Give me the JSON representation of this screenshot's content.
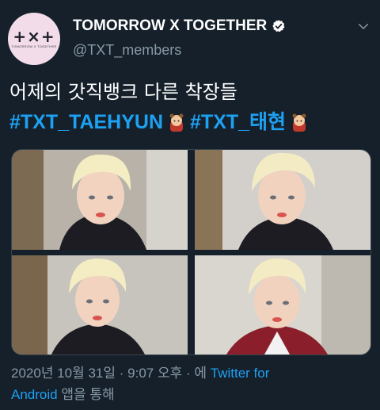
{
  "account": {
    "name": "TOMORROW X TOGETHER",
    "handle": "@TXT_members",
    "logo_text": "+×+",
    "logo_subtext": "TOMORROW X TOGETHER"
  },
  "tweet": {
    "text_line1": "어제의 갓직뱅크 다른 착장들",
    "hashtag1": "#TXT_TAEHYUN",
    "hashtag2": "#TXT_태현"
  },
  "meta": {
    "date": "2020년 10월 31일",
    "separator": "·",
    "time": "9:07 오후",
    "via_prefix": "· 에",
    "source_part1": "Twitter for",
    "source_part2": "Android",
    "via_suffix": "앱을 통해"
  },
  "colors": {
    "background": "#15202b",
    "accent": "#1da1f2",
    "secondary_text": "#8899a6"
  },
  "icons": [
    "verified-badge-icon",
    "chevron-down-icon",
    "bear-emoji-icon"
  ]
}
